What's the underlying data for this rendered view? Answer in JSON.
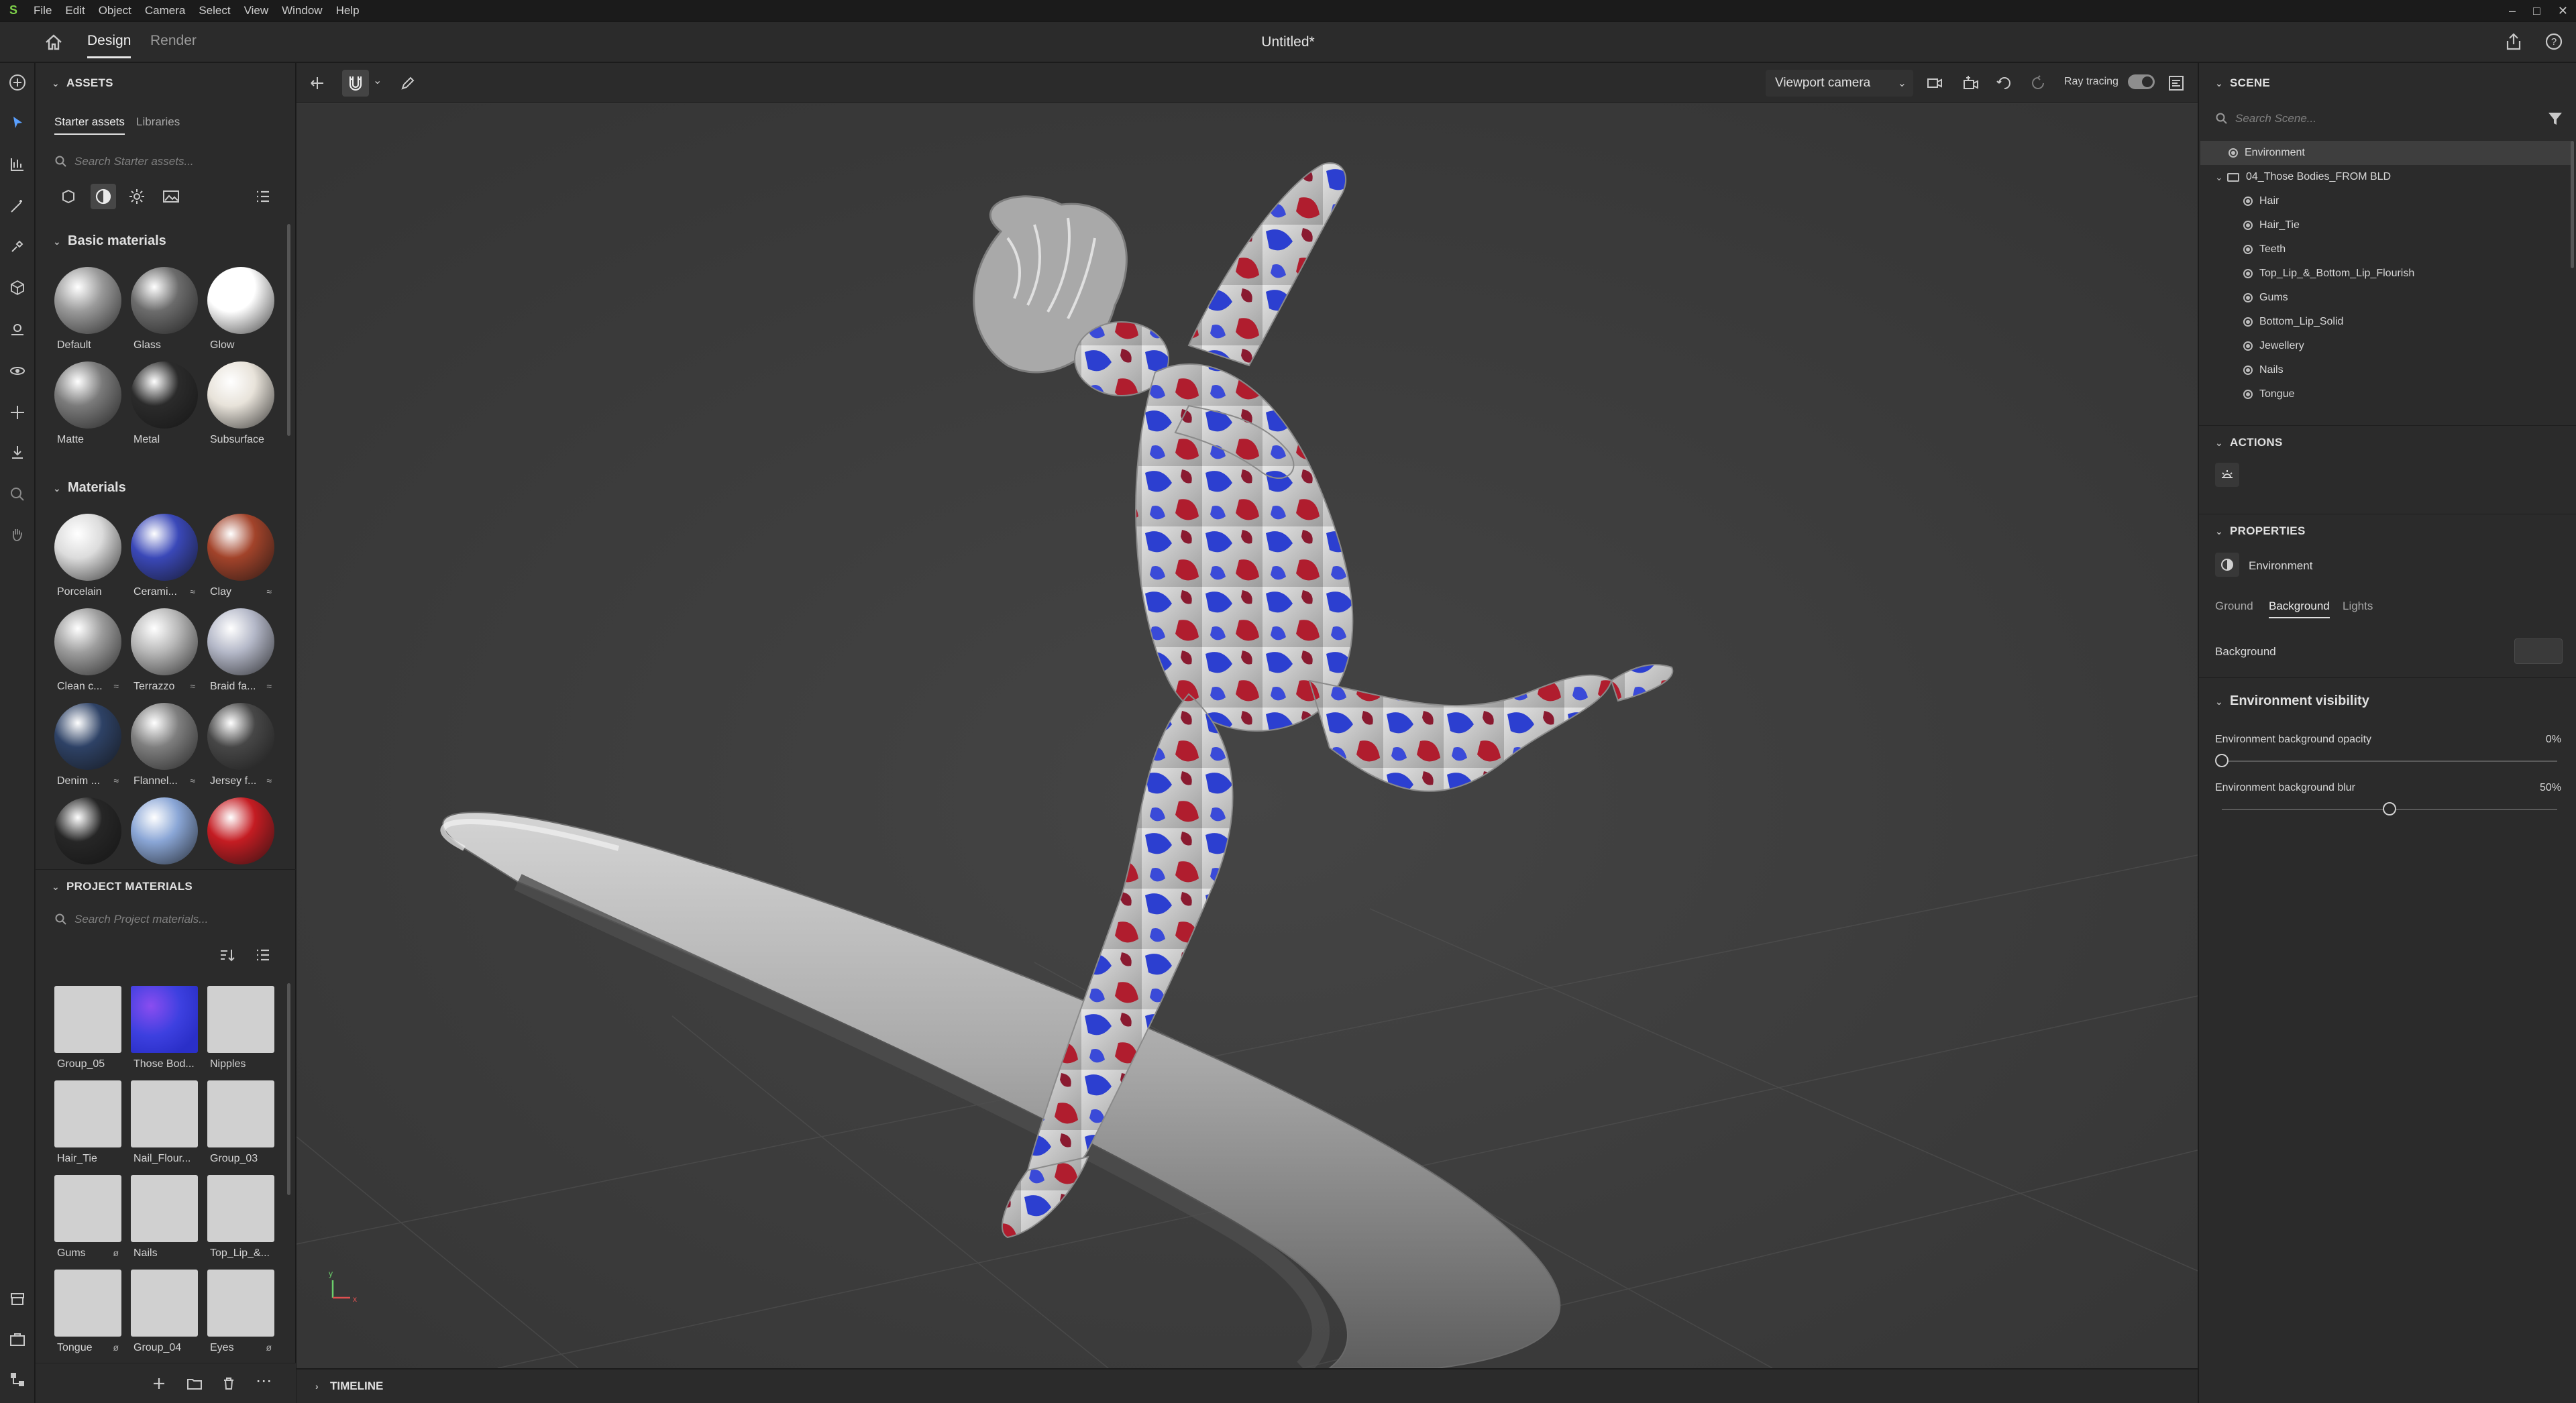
{
  "menubar": {
    "items": [
      "File",
      "Edit",
      "Object",
      "Camera",
      "Select",
      "View",
      "Window",
      "Help"
    ]
  },
  "titlebar": {
    "tabs": [
      {
        "label": "Design",
        "active": true
      },
      {
        "label": "Render",
        "active": false
      }
    ],
    "document_title": "Untitled*"
  },
  "assets": {
    "title": "ASSETS",
    "subtabs": [
      "Starter assets",
      "Libraries"
    ],
    "search_placeholder": "Search Starter assets...",
    "basic_materials": {
      "title": "Basic materials",
      "items": [
        {
          "label": "Default",
          "color": "#9a9a9a"
        },
        {
          "label": "Glass",
          "color": "#6c6c6c"
        },
        {
          "label": "Glow",
          "color": "#ffffff"
        },
        {
          "label": "Matte",
          "color": "#7b7b7b"
        },
        {
          "label": "Metal",
          "color": "#2b2b2b"
        },
        {
          "label": "Subsurface",
          "color": "#e8e3da"
        }
      ]
    },
    "materials": {
      "title": "Materials",
      "items": [
        {
          "label": "Porcelain",
          "color": "#dcdcdc",
          "tag": ""
        },
        {
          "label": "Cerami...",
          "color": "#3a48b8",
          "tag": "≈"
        },
        {
          "label": "Clay",
          "color": "#a2432a",
          "tag": "≈"
        },
        {
          "label": "Clean c...",
          "color": "#9d9d9d",
          "tag": "≈"
        },
        {
          "label": "Terrazzo",
          "color": "#b8b8b8",
          "tag": "≈"
        },
        {
          "label": "Braid fa...",
          "color": "#b4b8c8",
          "tag": "≈"
        },
        {
          "label": "Denim ...",
          "color": "#2e4266",
          "tag": "≈"
        },
        {
          "label": "Flannel...",
          "color": "#7f7f7f",
          "tag": "≈"
        },
        {
          "label": "Jersey f...",
          "color": "#474747",
          "tag": "≈"
        },
        {
          "label": "",
          "color": "#262626",
          "tag": ""
        },
        {
          "label": "",
          "color": "#8aa6d6",
          "tag": ""
        },
        {
          "label": "",
          "color": "#c41c22",
          "tag": ""
        }
      ]
    },
    "project_materials": {
      "title": "PROJECT MATERIALS",
      "search_placeholder": "Search Project materials...",
      "items": [
        {
          "label": "Group_05",
          "tag": ""
        },
        {
          "label": "Those Bod...",
          "tag": ""
        },
        {
          "label": "Nipples",
          "tag": ""
        },
        {
          "label": "Hair_Tie",
          "tag": ""
        },
        {
          "label": "Nail_Flour...",
          "tag": ""
        },
        {
          "label": "Group_03",
          "tag": ""
        },
        {
          "label": "Gums",
          "tag": "ø"
        },
        {
          "label": "Nails",
          "tag": ""
        },
        {
          "label": "Top_Lip_&...",
          "tag": ""
        },
        {
          "label": "Tongue",
          "tag": "ø"
        },
        {
          "label": "Group_04",
          "tag": ""
        },
        {
          "label": "Eyes",
          "tag": "ø"
        }
      ]
    }
  },
  "viewport": {
    "camera": "Viewport camera",
    "ray_tracing_label": "Ray tracing",
    "ray_tracing_on": true
  },
  "timeline": {
    "title": "TIMELINE"
  },
  "scene": {
    "title": "SCENE",
    "search_placeholder": "Search Scene...",
    "rows": [
      {
        "label": "Environment",
        "kind": "env",
        "indent": 0,
        "selected": true
      },
      {
        "label": "04_Those Bodies_FROM BLD",
        "kind": "folder",
        "indent": 0,
        "selected": false
      },
      {
        "label": "Hair",
        "kind": "obj",
        "indent": 1,
        "selected": false
      },
      {
        "label": "Hair_Tie",
        "kind": "obj",
        "indent": 1,
        "selected": false
      },
      {
        "label": "Teeth",
        "kind": "obj",
        "indent": 1,
        "selected": false
      },
      {
        "label": "Top_Lip_&_Bottom_Lip_Flourish",
        "kind": "obj",
        "indent": 1,
        "selected": false
      },
      {
        "label": "Gums",
        "kind": "obj",
        "indent": 1,
        "selected": false
      },
      {
        "label": "Bottom_Lip_Solid",
        "kind": "obj",
        "indent": 1,
        "selected": false
      },
      {
        "label": "Jewellery",
        "kind": "obj",
        "indent": 1,
        "selected": false
      },
      {
        "label": "Nails",
        "kind": "obj",
        "indent": 1,
        "selected": false
      },
      {
        "label": "Tongue",
        "kind": "obj",
        "indent": 1,
        "selected": false
      }
    ]
  },
  "actions": {
    "title": "ACTIONS"
  },
  "properties": {
    "title": "PROPERTIES",
    "object": "Environment",
    "tabs": [
      {
        "label": "Ground",
        "active": false
      },
      {
        "label": "Background",
        "active": true
      },
      {
        "label": "Lights",
        "active": false
      }
    ],
    "background_label": "Background",
    "background_color": "#3a3a3a",
    "env_visibility_title": "Environment visibility",
    "opacity_label": "Environment background opacity",
    "opacity_value": "0%",
    "opacity_fraction": 0.0,
    "blur_label": "Environment background blur",
    "blur_value": "50%",
    "blur_fraction": 0.5
  }
}
